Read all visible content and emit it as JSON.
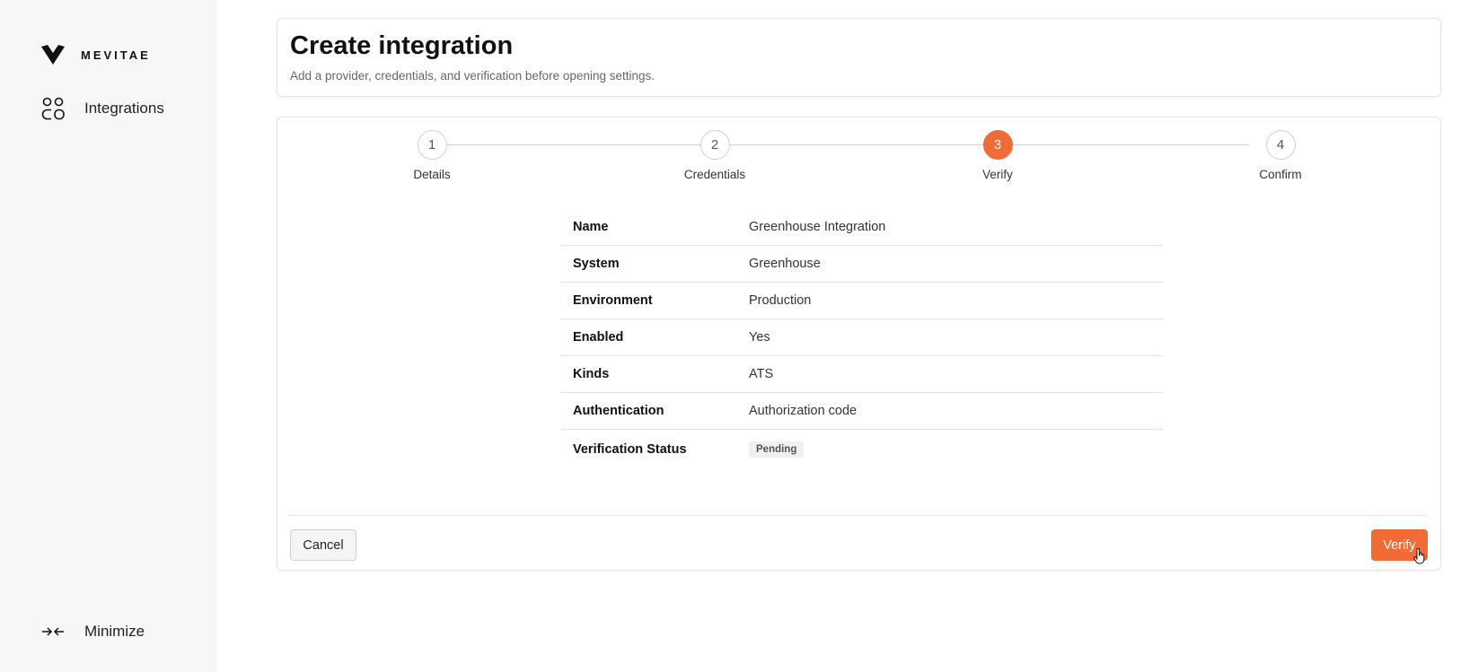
{
  "brand": {
    "name": "MEVITAE",
    "logo_icon": "chevron-v-logo"
  },
  "sidebar": {
    "items": [
      {
        "label": "Integrations",
        "icon": "people-icon"
      }
    ],
    "minimize": {
      "label": "Minimize",
      "icon": "collapse-arrows-icon"
    }
  },
  "header": {
    "title": "Create integration",
    "subtitle": "Add a provider, credentials, and verification before opening settings."
  },
  "stepper": {
    "active_index": 2,
    "steps": [
      {
        "number": "1",
        "label": "Details"
      },
      {
        "number": "2",
        "label": "Credentials"
      },
      {
        "number": "3",
        "label": "Verify"
      },
      {
        "number": "4",
        "label": "Confirm"
      }
    ]
  },
  "summary": {
    "rows": [
      {
        "key": "Name",
        "value": "Greenhouse Integration"
      },
      {
        "key": "System",
        "value": "Greenhouse"
      },
      {
        "key": "Environment",
        "value": "Production"
      },
      {
        "key": "Enabled",
        "value": "Yes"
      },
      {
        "key": "Kinds",
        "value": "ATS"
      },
      {
        "key": "Authentication",
        "value": "Authorization code"
      },
      {
        "key": "Verification Status",
        "value": "Pending"
      }
    ]
  },
  "footer": {
    "cancel_label": "Cancel",
    "verify_label": "Verify"
  },
  "colors": {
    "accent": "#f26a35",
    "sidebar_bg": "#f7f7f7",
    "border": "#e4e4e4"
  }
}
